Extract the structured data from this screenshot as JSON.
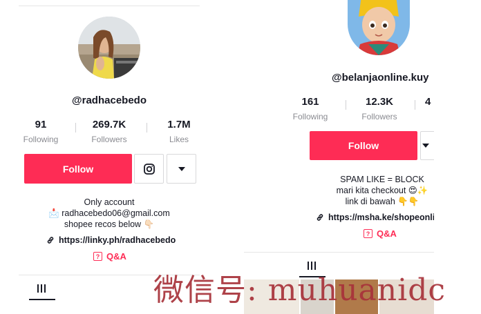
{
  "left_profile": {
    "username": "@radhacebedo",
    "stats": [
      {
        "value": "91",
        "label": "Following"
      },
      {
        "value": "269.7K",
        "label": "Followers"
      },
      {
        "value": "1.7M",
        "label": "Likes"
      }
    ],
    "follow_label": "Follow",
    "bio_line1": "Only account",
    "bio_line2": "📩 radhacebedo06@gmail.com",
    "bio_line3": "shopee recos below 👇🏻",
    "link": "https://linky.ph/radhacebedo",
    "qa_label": "Q&A",
    "qa_glyph": "?",
    "tab_icon": "grid-icon"
  },
  "right_profile": {
    "username": "@belanjaonline.kuy",
    "stats": [
      {
        "value": "161",
        "label": "Following"
      },
      {
        "value": "12.3K",
        "label": "Followers"
      },
      {
        "value": "4",
        "label": ""
      }
    ],
    "follow_label": "Follow",
    "bio_line1": "SPAM LIKE = BLOCK",
    "bio_line2": "mari kita checkout 😍✨",
    "bio_line3": "link di bawah 👇👇",
    "link": "https://msha.ke/shopeonlin",
    "qa_label": "Q&A",
    "qa_glyph": "?",
    "tab_icon": "grid-icon"
  },
  "watermark": "微信号: muhuanidc",
  "colors": {
    "accent": "#fe2c55",
    "text": "#161823",
    "muted": "#8a8b91"
  }
}
